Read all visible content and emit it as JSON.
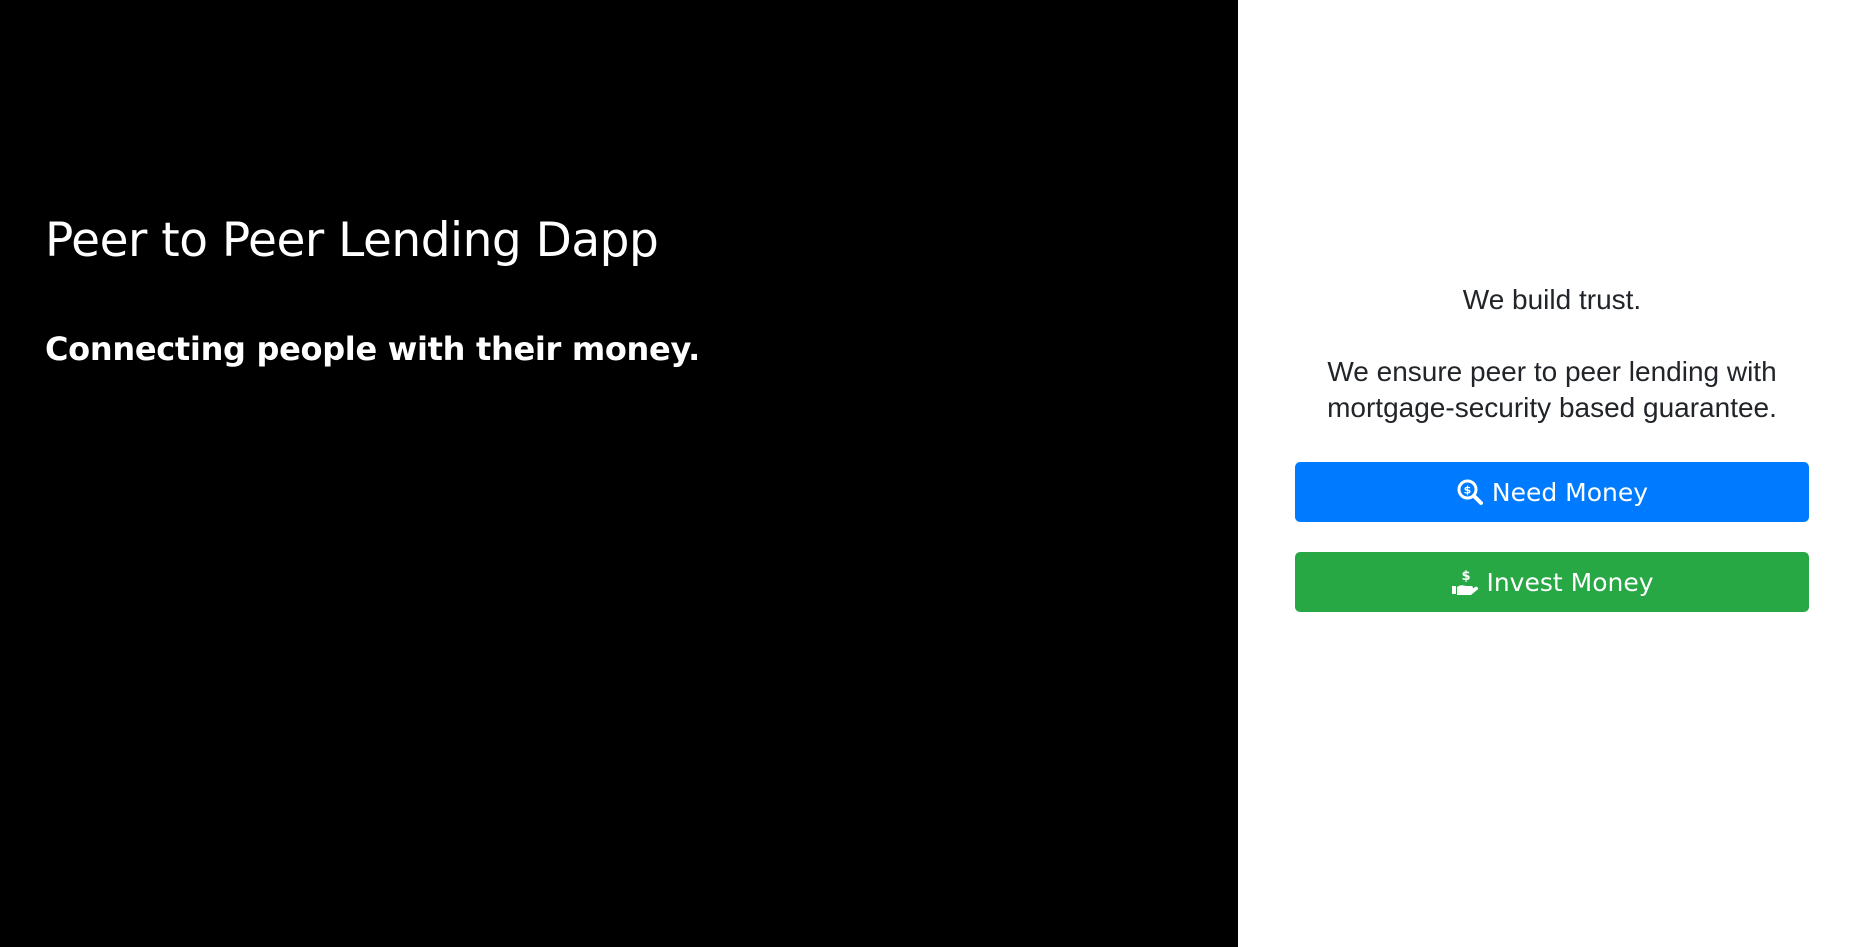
{
  "hero": {
    "title": "Peer to Peer Lending Dapp",
    "subtitle": "Connecting people with their money."
  },
  "panel": {
    "tagline_1": "We build trust.",
    "tagline_2": "We ensure peer to peer lending with mortgage-security based guarantee."
  },
  "buttons": {
    "need_money": {
      "label": "Need Money",
      "icon": "search-dollar-icon",
      "color": "#007bff"
    },
    "invest_money": {
      "label": "Invest Money",
      "icon": "hand-holding-usd-icon",
      "color": "#28a745"
    }
  },
  "colors": {
    "left_background": "#000000",
    "right_background": "#ffffff",
    "text_dark": "#212529"
  }
}
